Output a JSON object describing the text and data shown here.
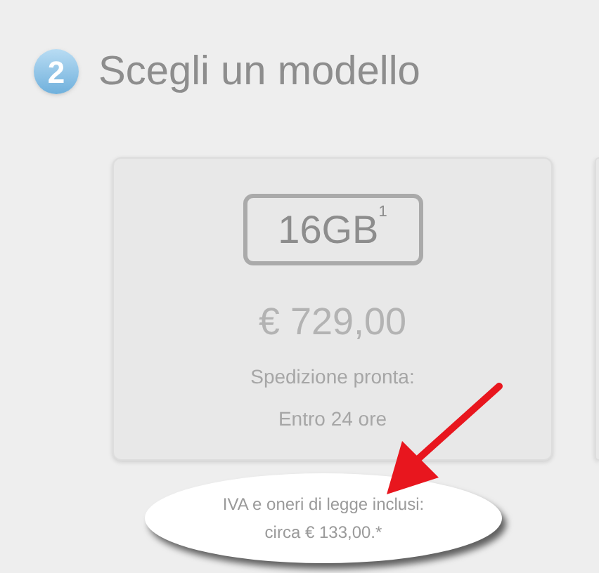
{
  "step": {
    "number": "2",
    "title": "Scegli un modello"
  },
  "models": [
    {
      "capacity": "16GB$^{1}$",
      "price": "€ 729,00",
      "shipping_label": "Spedizione pronta:",
      "shipping_time": "Entro 24 ore"
    }
  ],
  "callout": {
    "lines": [
      "IVA e oneri di legge inclusi:",
      "circa € 133,00.*"
    ]
  }
}
